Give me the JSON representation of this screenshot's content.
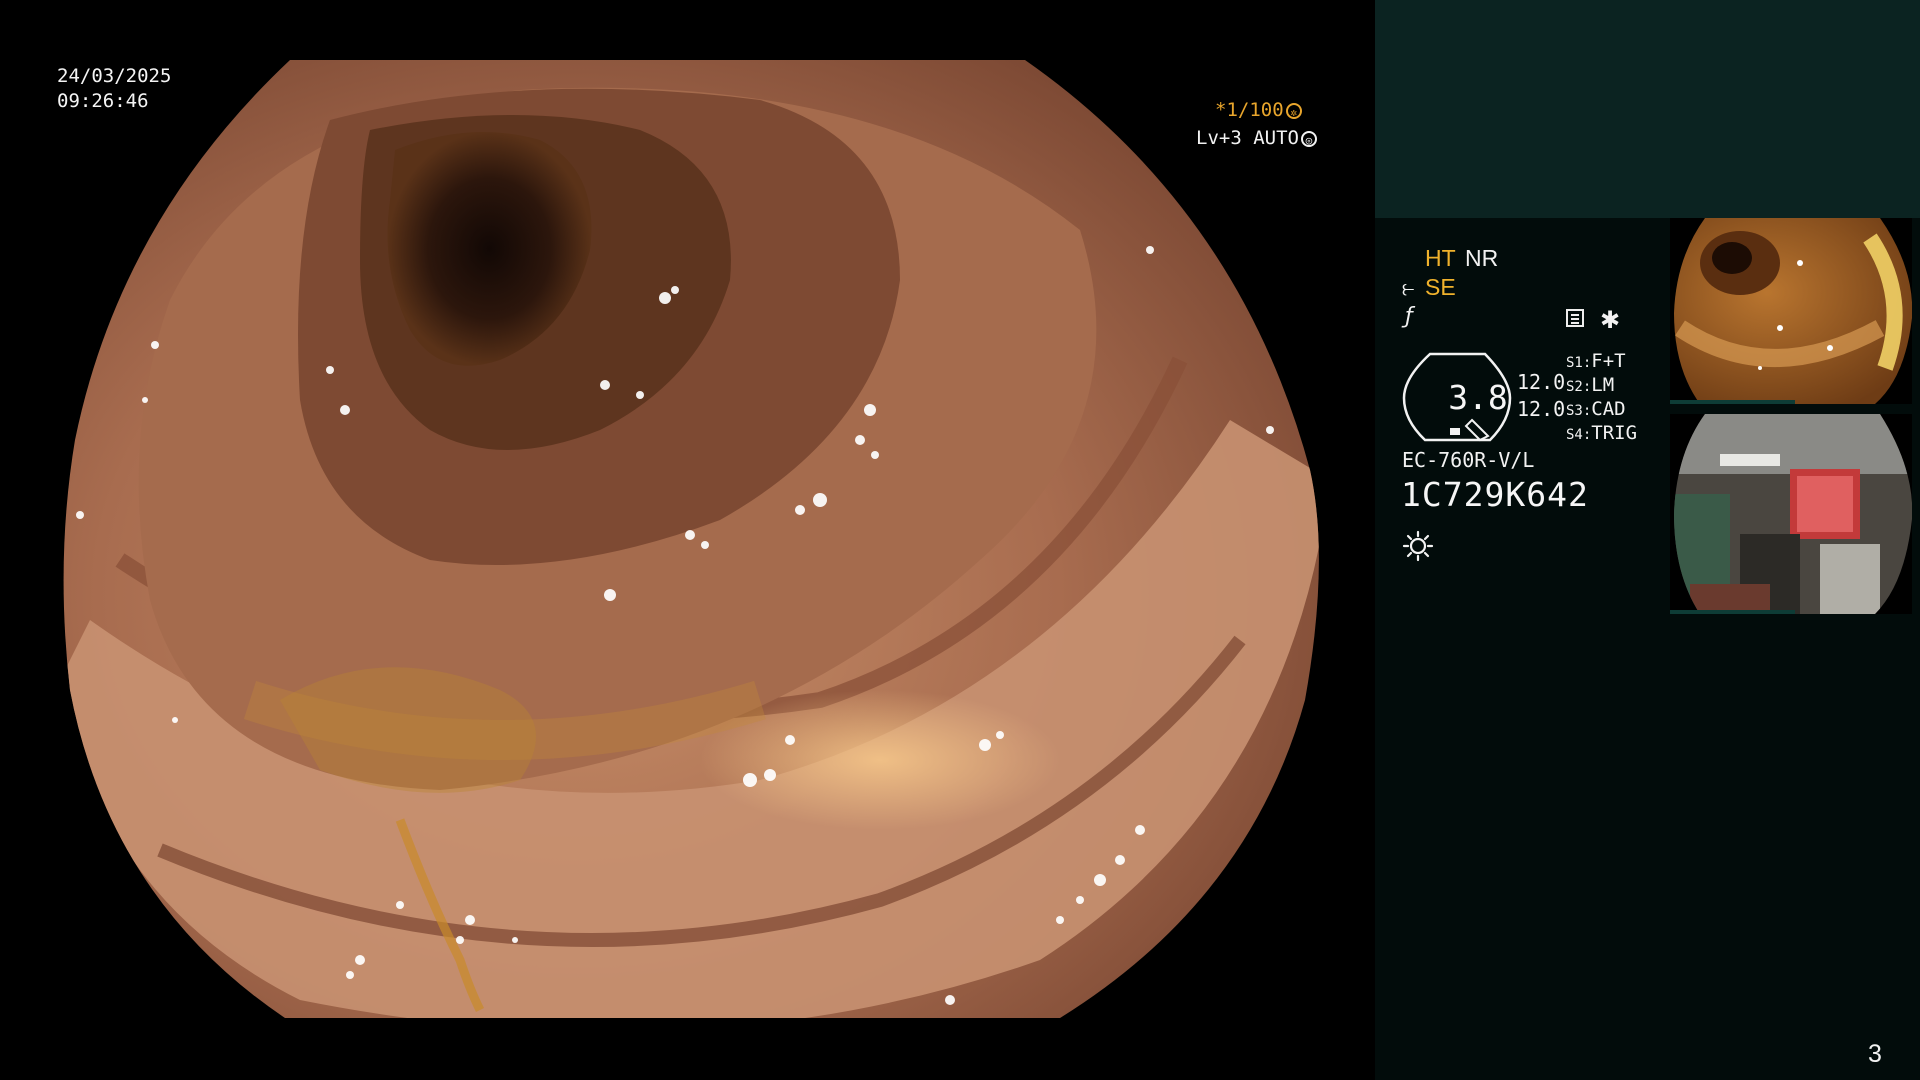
{
  "osd": {
    "date": "24/03/2025",
    "time": "09:26:46",
    "shutter": "*1/100",
    "shutter_icon": "aperture-icon",
    "level_auto": "Lv+3 AUTO",
    "level_icon": "iris-icon"
  },
  "panel": {
    "ht": "HT",
    "nr": "NR",
    "se": "SE",
    "gauge_value": "3.8",
    "gauge_num_1": "12.0",
    "gauge_num_2": "12.0",
    "modes": [
      {
        "key": "S1:",
        "value": "F+T"
      },
      {
        "key": "S2:",
        "value": "LM"
      },
      {
        "key": "S3:",
        "value": "CAD"
      },
      {
        "key": "S4:",
        "value": "TRIG"
      }
    ],
    "scope_model": "EC-760R-V/L",
    "serial": "1C729K642",
    "page_number": "3"
  },
  "colors": {
    "osd_accent": "#e8a52c",
    "panel_background": "#020c0b",
    "panel_top": "#0b2321"
  }
}
